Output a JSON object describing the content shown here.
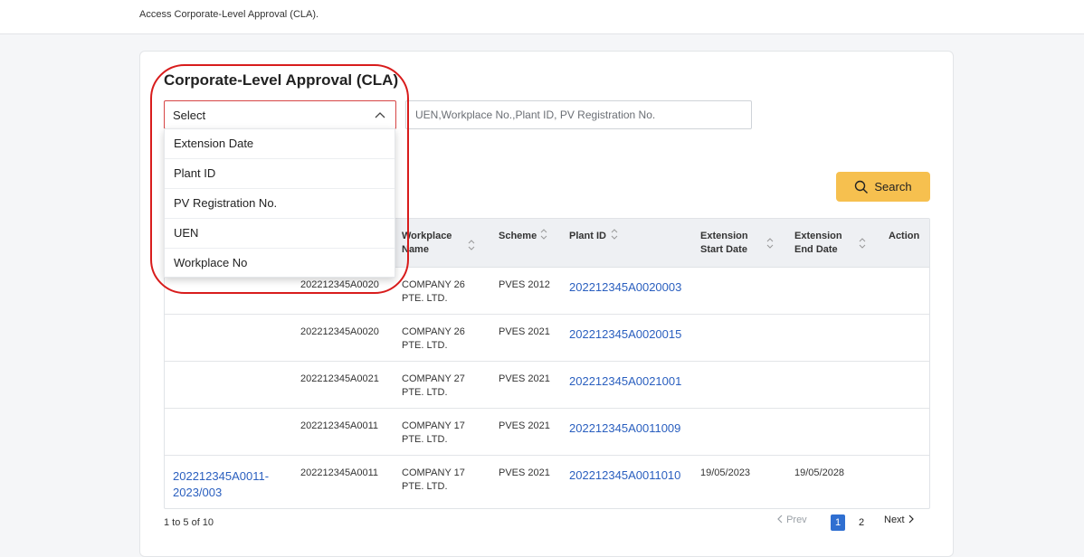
{
  "breadcrumb": "Access Corporate-Level Approval (CLA).",
  "page_title": "Corporate-Level Approval (CLA)",
  "filter": {
    "select_value": "Select",
    "options": [
      "Extension Date",
      "Plant ID",
      "PV Registration No.",
      "UEN",
      "Workplace No"
    ],
    "search_placeholder": "UEN,Workplace No.,Plant ID, PV Registration No.",
    "search_button": "Search"
  },
  "table": {
    "columns": [
      {
        "l1": "",
        "l2": ""
      },
      {
        "l1": "",
        "l2": ""
      },
      {
        "l1": "Workplace",
        "l2": "Name"
      },
      {
        "l1": "Scheme",
        "l2": ""
      },
      {
        "l1": "Plant ID",
        "l2": ""
      },
      {
        "l1": "Extension",
        "l2": "Start Date"
      },
      {
        "l1": "Extension",
        "l2": "End Date"
      },
      {
        "l1": "Action",
        "l2": ""
      }
    ],
    "rows": [
      {
        "cla_l1": "",
        "cla_l2": "",
        "uen": "202212345A0020",
        "wp_l1": "COMPANY 26",
        "wp_l2": "PTE. LTD.",
        "scheme": "PVES 2012",
        "plant_id": "202212345A0020003",
        "start": "",
        "end": ""
      },
      {
        "cla_l1": "",
        "cla_l2": "",
        "uen": "202212345A0020",
        "wp_l1": "COMPANY 26",
        "wp_l2": "PTE. LTD.",
        "scheme": "PVES 2021",
        "plant_id": "202212345A0020015",
        "start": "",
        "end": ""
      },
      {
        "cla_l1": "",
        "cla_l2": "",
        "uen": "202212345A0021",
        "wp_l1": "COMPANY 27",
        "wp_l2": "PTE. LTD.",
        "scheme": "PVES 2021",
        "plant_id": "202212345A0021001",
        "start": "",
        "end": ""
      },
      {
        "cla_l1": "",
        "cla_l2": "",
        "uen": "202212345A0011",
        "wp_l1": "COMPANY 17",
        "wp_l2": "PTE. LTD.",
        "scheme": "PVES 2021",
        "plant_id": "202212345A0011009",
        "start": "",
        "end": ""
      },
      {
        "cla_l1": "202212345A0011-",
        "cla_l2": "2023/003",
        "uen": "202212345A0011",
        "wp_l1": "COMPANY 17",
        "wp_l2": "PTE. LTD.",
        "scheme": "PVES 2021",
        "plant_id": "202212345A0011010",
        "start": "19/05/2023",
        "end": "19/05/2028"
      }
    ]
  },
  "pagination": {
    "summary": "1 to 5 of 10",
    "prev": "Prev",
    "pages": [
      "1",
      "2"
    ],
    "current": "1",
    "next": "Next"
  },
  "colors": {
    "accent": "#f6c04f",
    "link": "#2a5fbf",
    "highlight": "#d81c1c",
    "active_page": "#2f6fd1"
  }
}
